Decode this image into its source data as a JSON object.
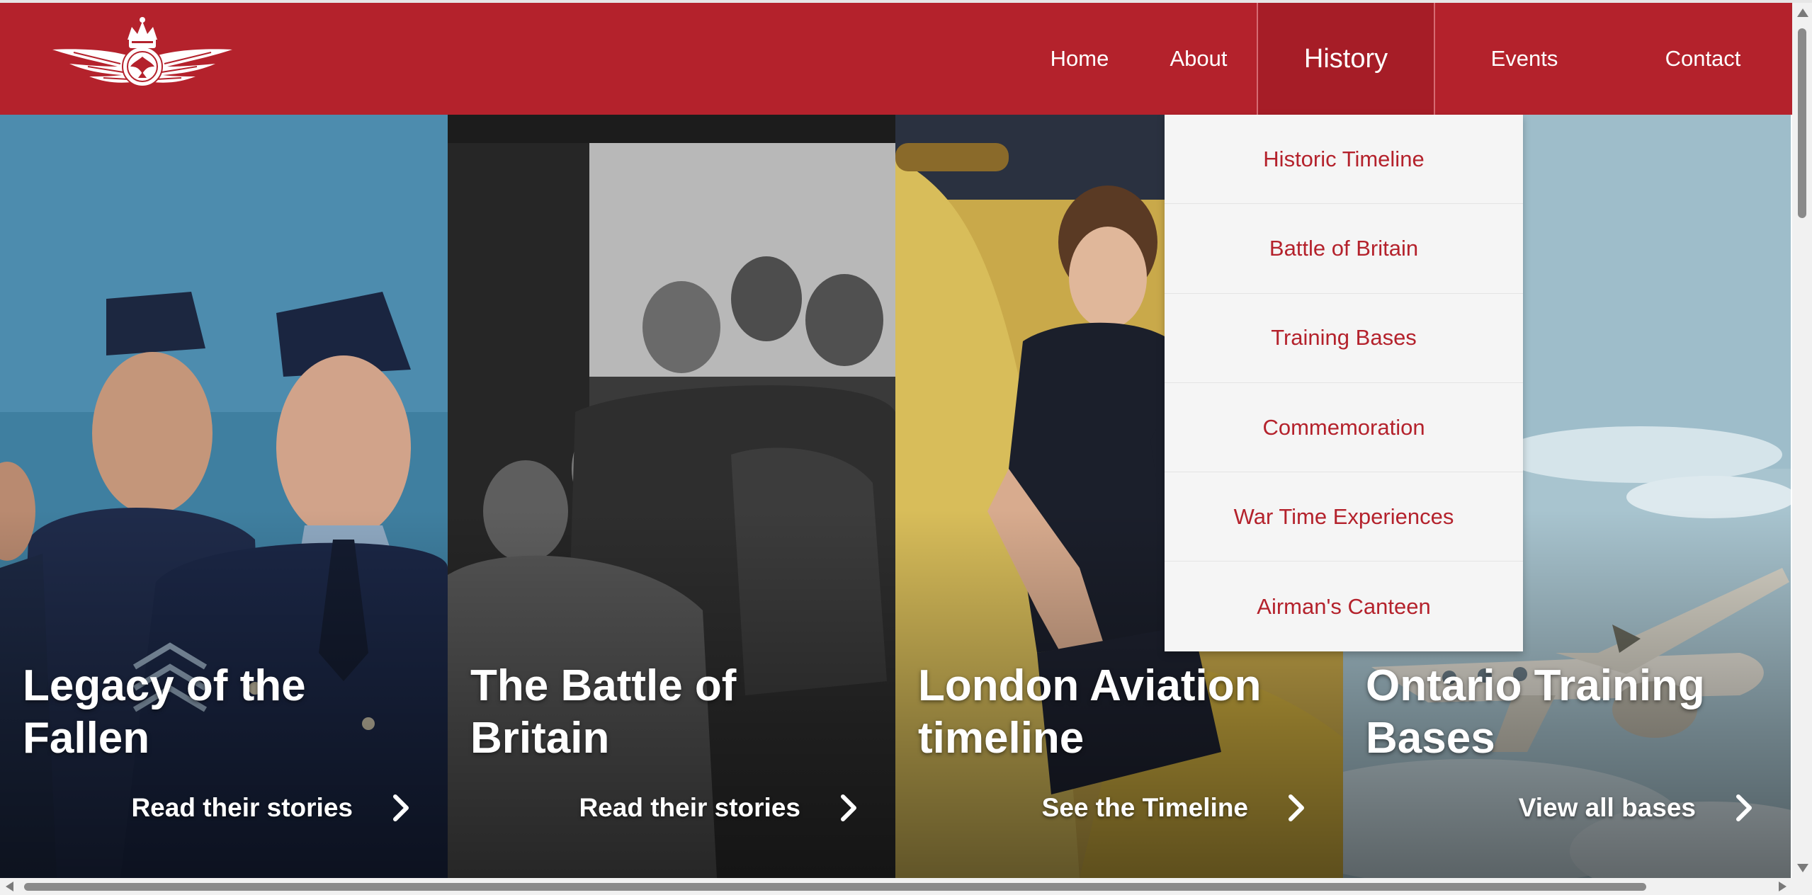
{
  "header": {
    "logo_icon": "rcaf-wings-crown-logo-icon",
    "background_color": "#b4222c"
  },
  "nav": {
    "items": [
      {
        "label": "Home"
      },
      {
        "label": "About"
      },
      {
        "label": "History"
      },
      {
        "label": "Events"
      },
      {
        "label": "Contact"
      }
    ],
    "active": "History"
  },
  "dropdown": {
    "items": [
      {
        "label": "Historic Timeline"
      },
      {
        "label": "Battle of Britain"
      },
      {
        "label": "Training Bases"
      },
      {
        "label": "Commemoration"
      },
      {
        "label": "War Time Experiences"
      },
      {
        "label": "Airman's Canteen"
      }
    ],
    "text_color": "#b4222c"
  },
  "panels": [
    {
      "title": "Legacy of the Fallen",
      "link": "Read their stories",
      "icon": "chevron-right-icon"
    },
    {
      "title": "The Battle of Britain",
      "link": "Read their stories",
      "icon": "chevron-right-icon"
    },
    {
      "title": "London Aviation timeline",
      "link": "See the Timeline",
      "icon": "chevron-right-icon"
    },
    {
      "title": "Ontario Training Bases",
      "link": "View all bases",
      "icon": "chevron-right-icon"
    }
  ]
}
